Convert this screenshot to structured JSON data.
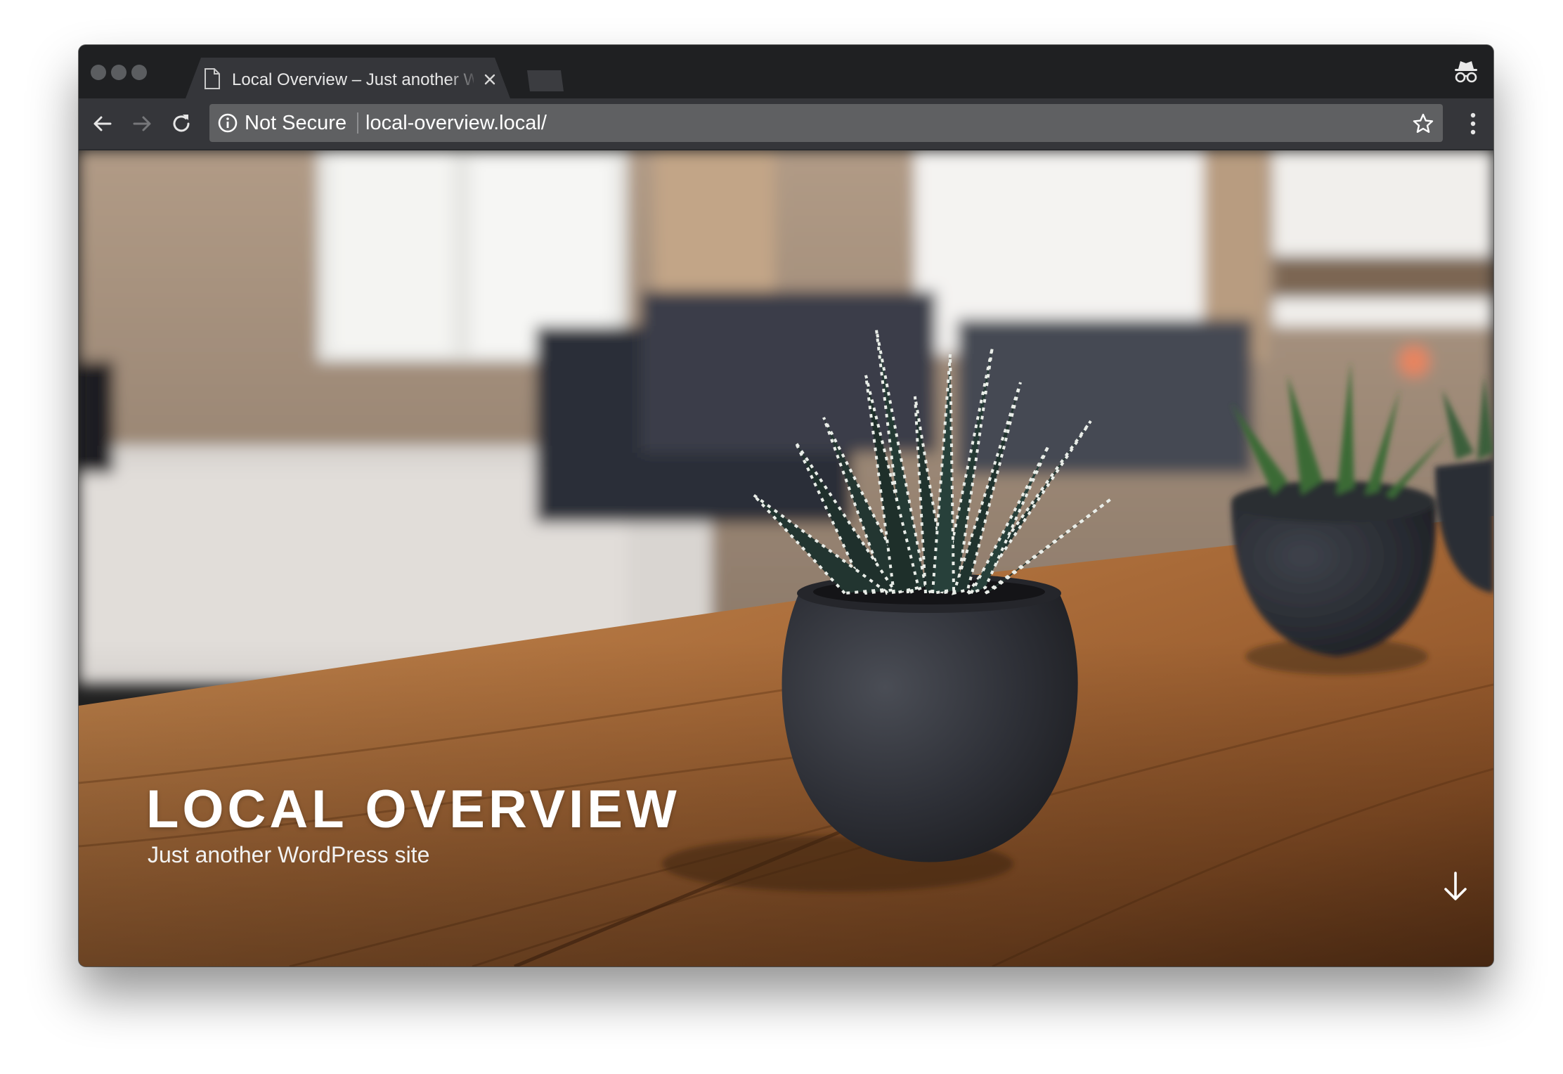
{
  "browser": {
    "tab": {
      "title": "Local Overview – Just another WordPress site",
      "icon": "page-icon",
      "close_icon": "close-icon"
    },
    "new_tab_icon": "new-tab",
    "profile_icon": "incognito-icon",
    "toolbar": {
      "back_icon": "back-arrow-icon",
      "forward_icon": "forward-arrow-icon",
      "reload_icon": "reload-icon",
      "security_icon": "info-icon",
      "security_label": "Not Secure",
      "url": "local-overview.local/",
      "bookmark_icon": "star-icon",
      "menu_icon": "more-vertical-icon"
    }
  },
  "page": {
    "site_title": "LOCAL OVERVIEW",
    "tagline": "Just another WordPress site",
    "scroll_icon": "arrow-down-icon"
  },
  "colors": {
    "tab_strip": "#1f2022",
    "toolbar": "#35363a",
    "omnibox": "#5f6062",
    "title_text": "#ffffff"
  }
}
